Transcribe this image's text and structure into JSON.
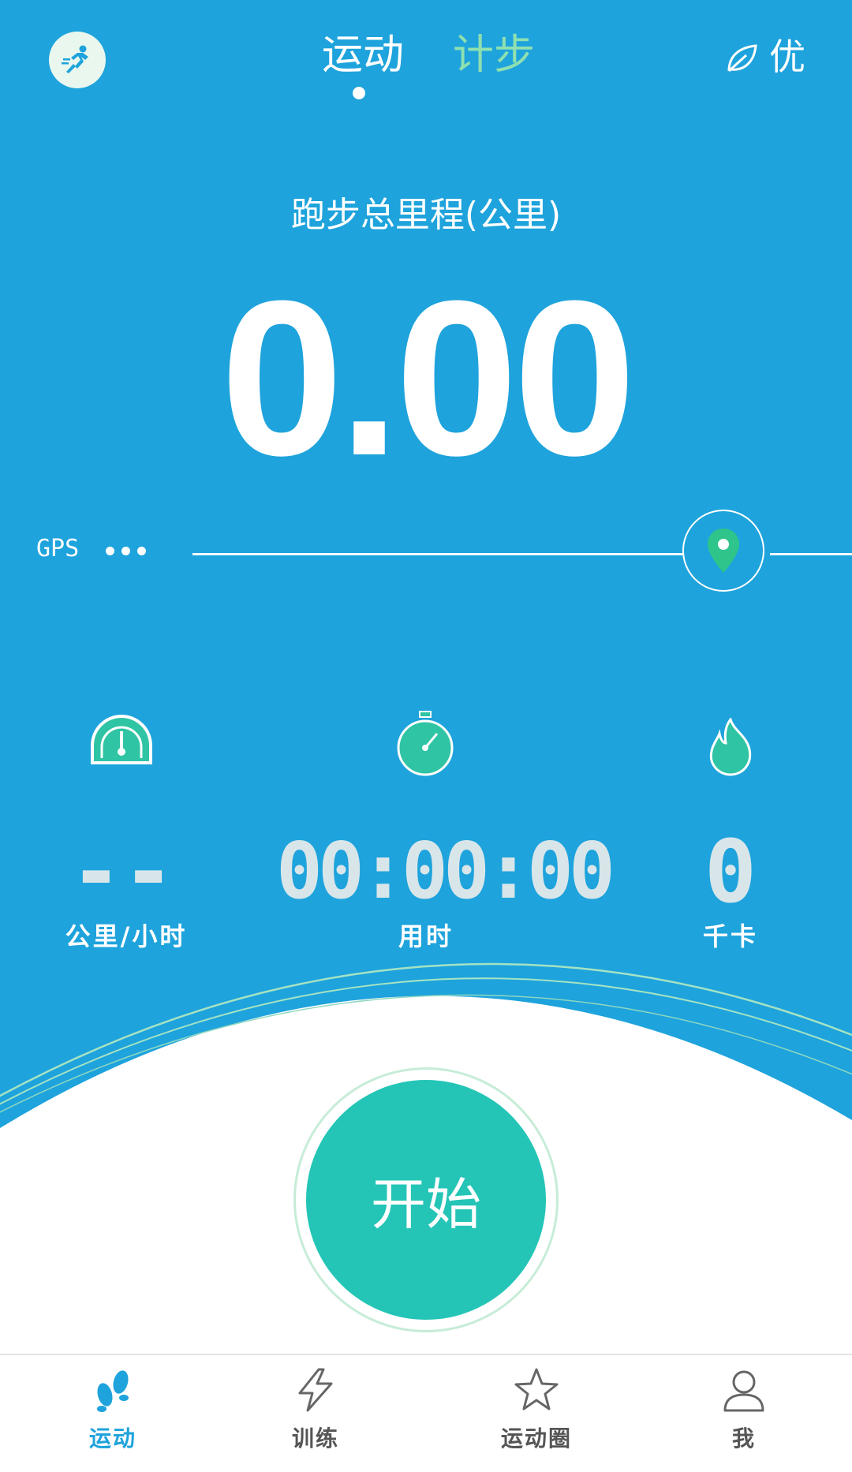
{
  "header": {
    "tabs": [
      {
        "label": "运动",
        "active": true
      },
      {
        "label": "计步",
        "active": false
      }
    ],
    "quality_label": "优"
  },
  "main": {
    "total_label": "跑步总里程(公里)",
    "total_value": "0.00",
    "gps_label": "GPS"
  },
  "stats": [
    {
      "icon": "speedometer-icon",
      "value": "--",
      "unit": "公里/小时"
    },
    {
      "icon": "stopwatch-icon",
      "value": "00:00:00",
      "unit": "用时"
    },
    {
      "icon": "flame-icon",
      "value": "0",
      "unit": "千卡"
    }
  ],
  "start_button": {
    "label": "开始"
  },
  "bottom_nav": [
    {
      "label": "运动",
      "icon": "footprints-icon",
      "active": true
    },
    {
      "label": "训练",
      "icon": "lightning-icon",
      "active": false
    },
    {
      "label": "运动圈",
      "icon": "star-icon",
      "active": false
    },
    {
      "label": "我",
      "icon": "user-icon",
      "active": false
    }
  ],
  "colors": {
    "primary_blue": "#1ea3dc",
    "accent_teal": "#24c5b6",
    "step_tab_green": "#8fe0b0",
    "gps_marker_green": "#2fc48a",
    "nav_active": "#1ea3dc",
    "nav_inactive": "#666666"
  }
}
